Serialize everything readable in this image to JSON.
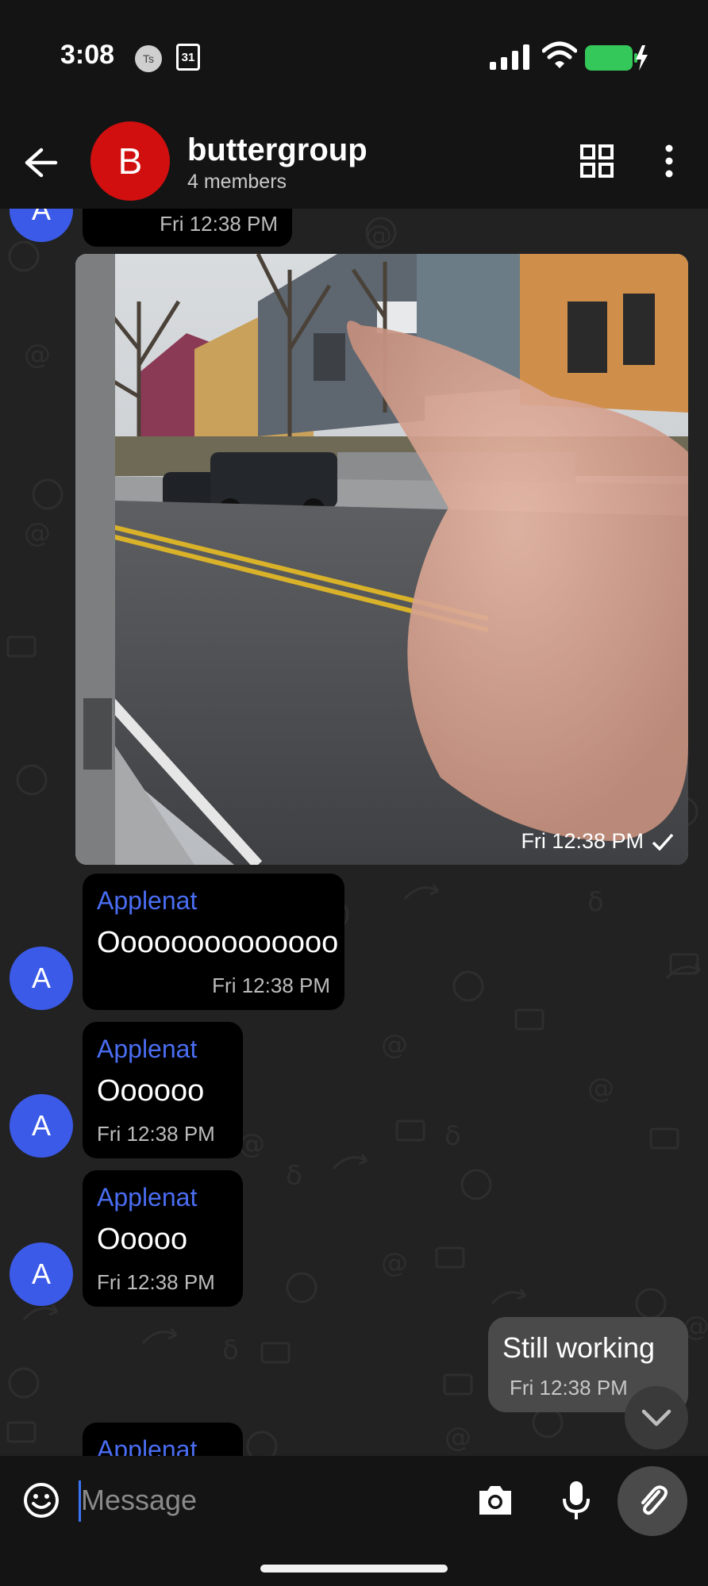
{
  "status_bar": {
    "time": "3:08",
    "ts_badge": "Ts",
    "calendar_day": "31",
    "icons": [
      "signal-icon",
      "wifi-icon",
      "battery-charging-icon"
    ],
    "battery_color": "#34c759"
  },
  "header": {
    "avatar_letter": "B",
    "avatar_color": "#d10f0f",
    "title": "buttergroup",
    "subtitle": "4 members",
    "icons": [
      "back-arrow-icon",
      "grid-icon",
      "more-vertical-icon"
    ]
  },
  "messages": [
    {
      "type": "text-partial",
      "avatar": "A",
      "time": "Fri 12:38 PM"
    },
    {
      "type": "photo",
      "time": "Fri 12:38 PM",
      "status": "sent-check-icon"
    },
    {
      "type": "text",
      "avatar": "A",
      "sender": "Applenat",
      "text": "Oooooooooooooo",
      "time": "Fri 12:38 PM"
    },
    {
      "type": "text",
      "avatar": "A",
      "sender": "Applenat",
      "text": "Oooooo",
      "time": "Fri 12:38 PM"
    },
    {
      "type": "text",
      "avatar": "A",
      "sender": "Applenat",
      "text": "Ooooo",
      "time": "Fri 12:38 PM"
    },
    {
      "type": "outgoing",
      "text": "Still working",
      "time": "Fri 12:38 PM"
    },
    {
      "type": "text-partial",
      "sender": "Applenat"
    }
  ],
  "accent_colors": {
    "sender_name": "#4a6df2",
    "avatar_a": "#3b5ae8",
    "background": "#222222"
  },
  "composer": {
    "placeholder": "Message",
    "icons": [
      "emoji-icon",
      "camera-icon",
      "microphone-icon",
      "paperclip-icon"
    ]
  },
  "scroll_button": {
    "icon": "chevron-down-icon"
  }
}
